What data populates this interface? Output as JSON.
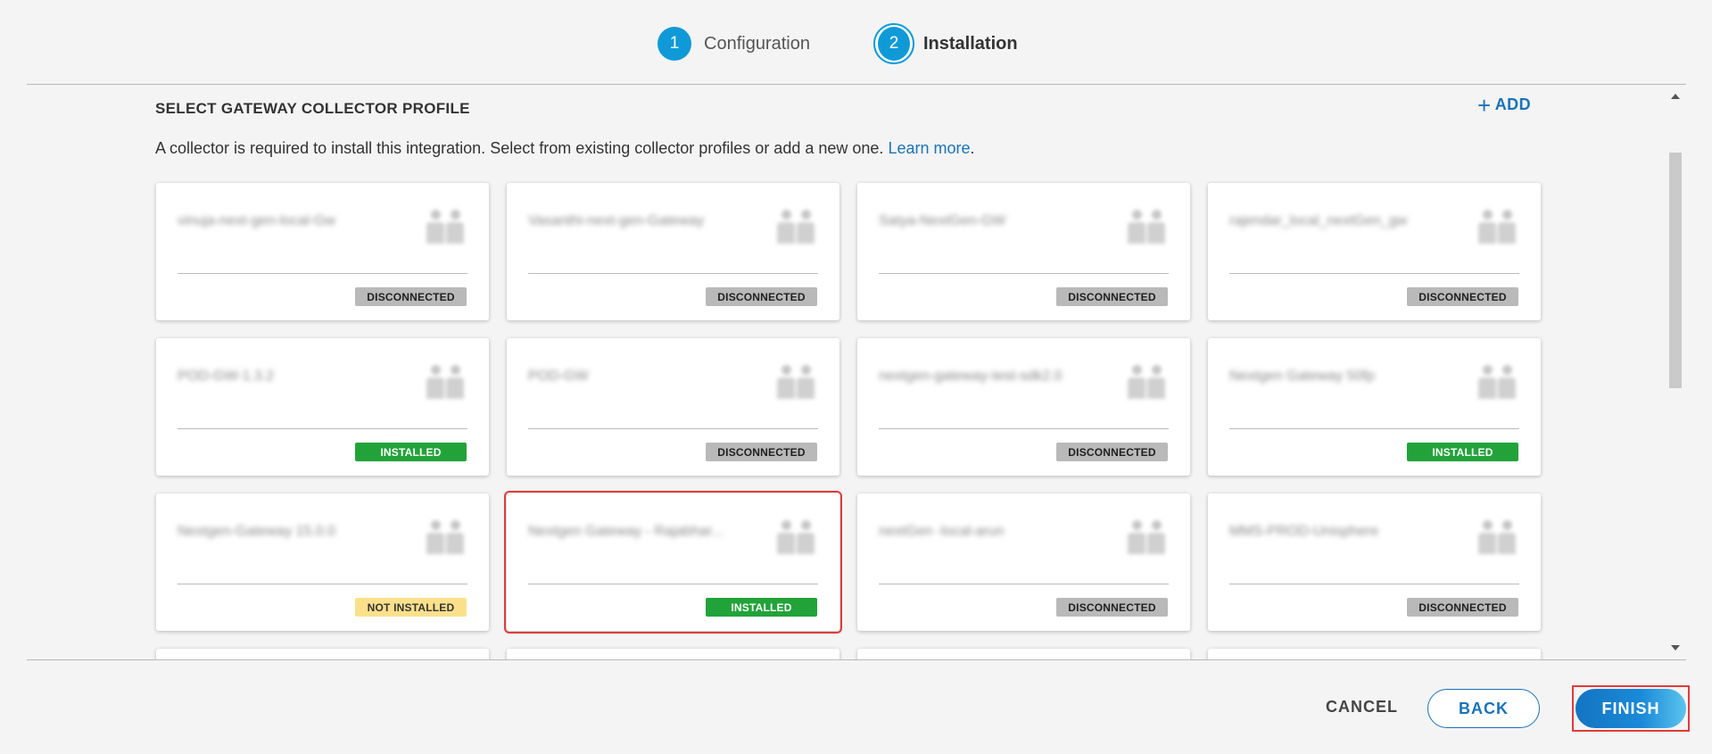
{
  "stepper": {
    "steps": [
      {
        "number": "1",
        "label": "Configuration"
      },
      {
        "number": "2",
        "label": "Installation"
      }
    ]
  },
  "section": {
    "title": "SELECT GATEWAY COLLECTOR PROFILE",
    "add_label": "ADD",
    "description": "A collector is required to install this integration. Select from existing collector profiles or add a new one.",
    "learn_more": "Learn more",
    "desc_end": "."
  },
  "cards": [
    {
      "name": "vinuja-next-gen-local-Gw",
      "status": "DISCONNECTED"
    },
    {
      "name": "Vasanthi-next-gen-Gateway",
      "status": "DISCONNECTED"
    },
    {
      "name": "Satya-NextGen-GW",
      "status": "DISCONNECTED"
    },
    {
      "name": "rajendar_local_nextGen_gw",
      "status": "DISCONNECTED"
    },
    {
      "name": "POD-GW-1.3.2",
      "status": "INSTALLED"
    },
    {
      "name": "POD-GW",
      "status": "DISCONNECTED"
    },
    {
      "name": "nextgen-gateway-test-sdk2.0",
      "status": "DISCONNECTED"
    },
    {
      "name": "Nextgen Gateway 50fp",
      "status": "INSTALLED"
    },
    {
      "name": "Nextgen-Gateway 15.0.0",
      "status": "NOT INSTALLED"
    },
    {
      "name": "Nextgen Gateway - Rajabhar...",
      "status": "INSTALLED",
      "selected": true
    },
    {
      "name": "nextGen -local-arun",
      "status": "DISCONNECTED"
    },
    {
      "name": "MMS-PROD-Unisphere",
      "status": "DISCONNECTED"
    }
  ],
  "footer": {
    "cancel": "CANCEL",
    "back": "BACK",
    "finish": "FINISH"
  },
  "colors": {
    "accent": "#0f9ad7",
    "link": "#1a73b8",
    "installed": "#22a33a",
    "disconnected": "#b9b9b9",
    "not_installed": "#fbe08c",
    "highlight": "#e23b3b"
  }
}
